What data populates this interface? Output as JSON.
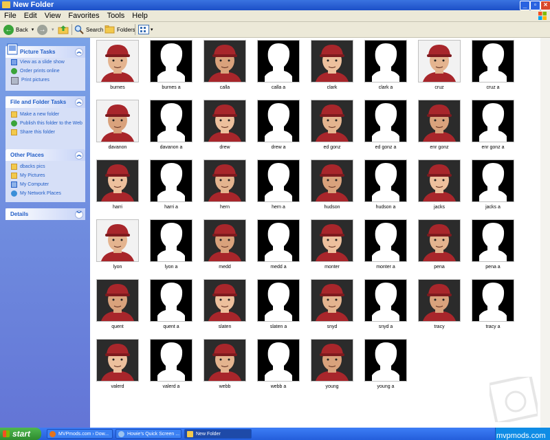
{
  "window": {
    "title": "New Folder"
  },
  "menu": [
    "File",
    "Edit",
    "View",
    "Favorites",
    "Tools",
    "Help"
  ],
  "toolbar": {
    "back": "Back",
    "search": "Search",
    "folders": "Folders"
  },
  "sidebar": {
    "picture_tasks": {
      "title": "Picture Tasks",
      "items": [
        "View as a slide show",
        "Order prints online",
        "Print pictures"
      ]
    },
    "file_tasks": {
      "title": "File and Folder Tasks",
      "items": [
        "Make a new folder",
        "Publish this folder to the Web",
        "Share this folder"
      ]
    },
    "other_places": {
      "title": "Other Places",
      "items": [
        "dbacks pics",
        "My Pictures",
        "My Computer",
        "My Network Places"
      ]
    },
    "details": {
      "title": "Details"
    }
  },
  "files": [
    {
      "name": "burnes",
      "type": "photo"
    },
    {
      "name": "burnes a",
      "type": "mask"
    },
    {
      "name": "calla",
      "type": "photo"
    },
    {
      "name": "calla a",
      "type": "mask"
    },
    {
      "name": "clark",
      "type": "photo"
    },
    {
      "name": "clark a",
      "type": "mask"
    },
    {
      "name": "cruz",
      "type": "photo"
    },
    {
      "name": "cruz a",
      "type": "mask"
    },
    {
      "name": "davanon",
      "type": "photo"
    },
    {
      "name": "davanon a",
      "type": "mask"
    },
    {
      "name": "drew",
      "type": "photo"
    },
    {
      "name": "drew a",
      "type": "mask"
    },
    {
      "name": "ed gonz",
      "type": "photo"
    },
    {
      "name": "ed gonz a",
      "type": "mask"
    },
    {
      "name": "enr gonz",
      "type": "photo"
    },
    {
      "name": "enr gonz a",
      "type": "mask"
    },
    {
      "name": "harri",
      "type": "photo"
    },
    {
      "name": "harri a",
      "type": "mask"
    },
    {
      "name": "hern",
      "type": "photo"
    },
    {
      "name": "hern a",
      "type": "mask"
    },
    {
      "name": "hudson",
      "type": "photo"
    },
    {
      "name": "hudson a",
      "type": "mask"
    },
    {
      "name": "jacks",
      "type": "photo"
    },
    {
      "name": "jacks a",
      "type": "mask"
    },
    {
      "name": "lyon",
      "type": "photo"
    },
    {
      "name": "lyon a",
      "type": "mask"
    },
    {
      "name": "medd",
      "type": "photo"
    },
    {
      "name": "medd a",
      "type": "mask"
    },
    {
      "name": "monter",
      "type": "photo"
    },
    {
      "name": "monter a",
      "type": "mask"
    },
    {
      "name": "pena",
      "type": "photo"
    },
    {
      "name": "pena a",
      "type": "mask"
    },
    {
      "name": "quent",
      "type": "photo"
    },
    {
      "name": "quent a",
      "type": "mask"
    },
    {
      "name": "slaten",
      "type": "photo"
    },
    {
      "name": "slaten a",
      "type": "mask"
    },
    {
      "name": "snyd",
      "type": "photo"
    },
    {
      "name": "snyd a",
      "type": "mask"
    },
    {
      "name": "tracy",
      "type": "photo"
    },
    {
      "name": "tracy a",
      "type": "mask"
    },
    {
      "name": "valerd",
      "type": "photo"
    },
    {
      "name": "valerd a",
      "type": "mask"
    },
    {
      "name": "webb",
      "type": "photo"
    },
    {
      "name": "webb a",
      "type": "mask"
    },
    {
      "name": "young",
      "type": "photo"
    },
    {
      "name": "young a",
      "type": "mask"
    }
  ],
  "taskbar": {
    "start": "start",
    "tasks": [
      "MVPmods.com › Dow...",
      "Howie's Quick Screen ...",
      "New Folder"
    ],
    "watermark": "mvpmods.com"
  },
  "colors": {
    "cap_red": "#a8262b",
    "mask_bg": "#000000",
    "mask_fg": "#ffffff"
  }
}
